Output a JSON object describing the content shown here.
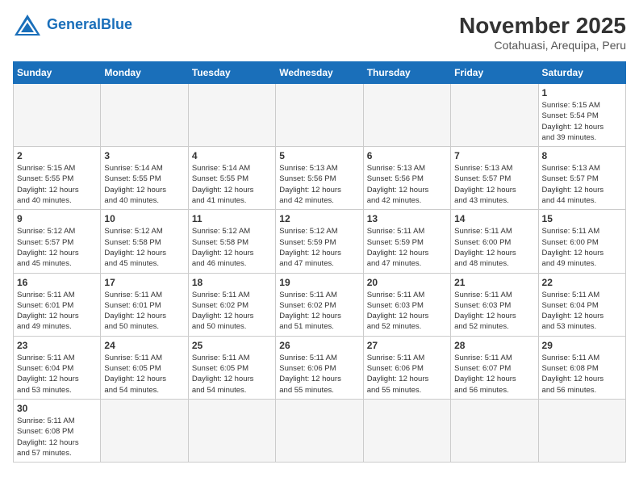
{
  "header": {
    "logo_general": "General",
    "logo_blue": "Blue",
    "month_year": "November 2025",
    "location": "Cotahuasi, Arequipa, Peru"
  },
  "days_of_week": [
    "Sunday",
    "Monday",
    "Tuesday",
    "Wednesday",
    "Thursday",
    "Friday",
    "Saturday"
  ],
  "weeks": [
    [
      {
        "day": "",
        "info": ""
      },
      {
        "day": "",
        "info": ""
      },
      {
        "day": "",
        "info": ""
      },
      {
        "day": "",
        "info": ""
      },
      {
        "day": "",
        "info": ""
      },
      {
        "day": "",
        "info": ""
      },
      {
        "day": "1",
        "info": "Sunrise: 5:15 AM\nSunset: 5:54 PM\nDaylight: 12 hours\nand 39 minutes."
      }
    ],
    [
      {
        "day": "2",
        "info": "Sunrise: 5:15 AM\nSunset: 5:55 PM\nDaylight: 12 hours\nand 40 minutes."
      },
      {
        "day": "3",
        "info": "Sunrise: 5:14 AM\nSunset: 5:55 PM\nDaylight: 12 hours\nand 40 minutes."
      },
      {
        "day": "4",
        "info": "Sunrise: 5:14 AM\nSunset: 5:55 PM\nDaylight: 12 hours\nand 41 minutes."
      },
      {
        "day": "5",
        "info": "Sunrise: 5:13 AM\nSunset: 5:56 PM\nDaylight: 12 hours\nand 42 minutes."
      },
      {
        "day": "6",
        "info": "Sunrise: 5:13 AM\nSunset: 5:56 PM\nDaylight: 12 hours\nand 42 minutes."
      },
      {
        "day": "7",
        "info": "Sunrise: 5:13 AM\nSunset: 5:57 PM\nDaylight: 12 hours\nand 43 minutes."
      },
      {
        "day": "8",
        "info": "Sunrise: 5:13 AM\nSunset: 5:57 PM\nDaylight: 12 hours\nand 44 minutes."
      }
    ],
    [
      {
        "day": "9",
        "info": "Sunrise: 5:12 AM\nSunset: 5:57 PM\nDaylight: 12 hours\nand 45 minutes."
      },
      {
        "day": "10",
        "info": "Sunrise: 5:12 AM\nSunset: 5:58 PM\nDaylight: 12 hours\nand 45 minutes."
      },
      {
        "day": "11",
        "info": "Sunrise: 5:12 AM\nSunset: 5:58 PM\nDaylight: 12 hours\nand 46 minutes."
      },
      {
        "day": "12",
        "info": "Sunrise: 5:12 AM\nSunset: 5:59 PM\nDaylight: 12 hours\nand 47 minutes."
      },
      {
        "day": "13",
        "info": "Sunrise: 5:11 AM\nSunset: 5:59 PM\nDaylight: 12 hours\nand 47 minutes."
      },
      {
        "day": "14",
        "info": "Sunrise: 5:11 AM\nSunset: 6:00 PM\nDaylight: 12 hours\nand 48 minutes."
      },
      {
        "day": "15",
        "info": "Sunrise: 5:11 AM\nSunset: 6:00 PM\nDaylight: 12 hours\nand 49 minutes."
      }
    ],
    [
      {
        "day": "16",
        "info": "Sunrise: 5:11 AM\nSunset: 6:01 PM\nDaylight: 12 hours\nand 49 minutes."
      },
      {
        "day": "17",
        "info": "Sunrise: 5:11 AM\nSunset: 6:01 PM\nDaylight: 12 hours\nand 50 minutes."
      },
      {
        "day": "18",
        "info": "Sunrise: 5:11 AM\nSunset: 6:02 PM\nDaylight: 12 hours\nand 50 minutes."
      },
      {
        "day": "19",
        "info": "Sunrise: 5:11 AM\nSunset: 6:02 PM\nDaylight: 12 hours\nand 51 minutes."
      },
      {
        "day": "20",
        "info": "Sunrise: 5:11 AM\nSunset: 6:03 PM\nDaylight: 12 hours\nand 52 minutes."
      },
      {
        "day": "21",
        "info": "Sunrise: 5:11 AM\nSunset: 6:03 PM\nDaylight: 12 hours\nand 52 minutes."
      },
      {
        "day": "22",
        "info": "Sunrise: 5:11 AM\nSunset: 6:04 PM\nDaylight: 12 hours\nand 53 minutes."
      }
    ],
    [
      {
        "day": "23",
        "info": "Sunrise: 5:11 AM\nSunset: 6:04 PM\nDaylight: 12 hours\nand 53 minutes."
      },
      {
        "day": "24",
        "info": "Sunrise: 5:11 AM\nSunset: 6:05 PM\nDaylight: 12 hours\nand 54 minutes."
      },
      {
        "day": "25",
        "info": "Sunrise: 5:11 AM\nSunset: 6:05 PM\nDaylight: 12 hours\nand 54 minutes."
      },
      {
        "day": "26",
        "info": "Sunrise: 5:11 AM\nSunset: 6:06 PM\nDaylight: 12 hours\nand 55 minutes."
      },
      {
        "day": "27",
        "info": "Sunrise: 5:11 AM\nSunset: 6:06 PM\nDaylight: 12 hours\nand 55 minutes."
      },
      {
        "day": "28",
        "info": "Sunrise: 5:11 AM\nSunset: 6:07 PM\nDaylight: 12 hours\nand 56 minutes."
      },
      {
        "day": "29",
        "info": "Sunrise: 5:11 AM\nSunset: 6:08 PM\nDaylight: 12 hours\nand 56 minutes."
      }
    ],
    [
      {
        "day": "30",
        "info": "Sunrise: 5:11 AM\nSunset: 6:08 PM\nDaylight: 12 hours\nand 57 minutes."
      },
      {
        "day": "",
        "info": ""
      },
      {
        "day": "",
        "info": ""
      },
      {
        "day": "",
        "info": ""
      },
      {
        "day": "",
        "info": ""
      },
      {
        "day": "",
        "info": ""
      },
      {
        "day": "",
        "info": ""
      }
    ]
  ]
}
